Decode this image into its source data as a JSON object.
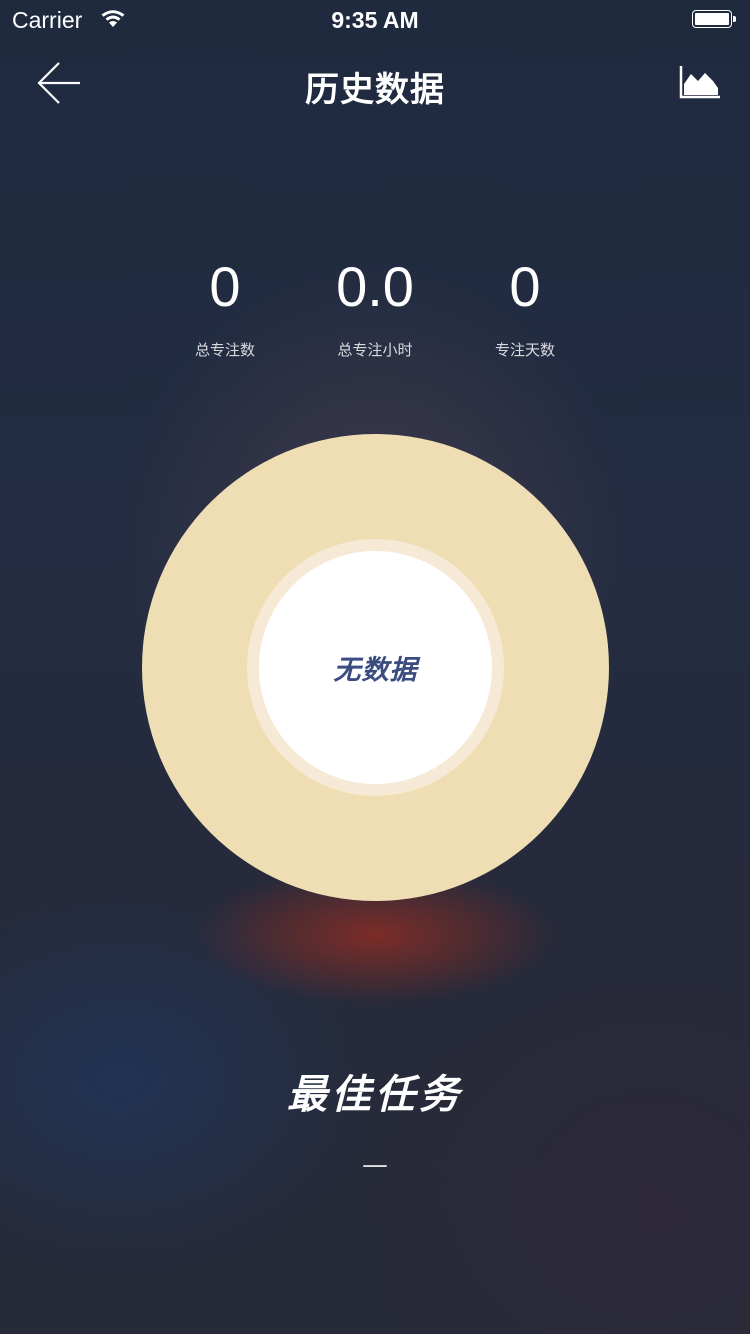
{
  "status_bar": {
    "carrier": "Carrier",
    "time": "9:35 AM"
  },
  "nav": {
    "title": "历史数据",
    "back_icon": "arrow-left-icon",
    "chart_icon": "area-chart-icon"
  },
  "stats": [
    {
      "value": "0",
      "label": "总专注数"
    },
    {
      "value": "0.0",
      "label": "总专注小时"
    },
    {
      "value": "0",
      "label": "专注天数"
    }
  ],
  "ring_chart": {
    "empty_text": "无数据",
    "colors": {
      "ring": "#efdeb4",
      "inner": "#f6ead6",
      "core": "#ffffff",
      "text": "#3a4c80"
    }
  },
  "best_task": {
    "title": "最佳任务",
    "value": "—"
  }
}
